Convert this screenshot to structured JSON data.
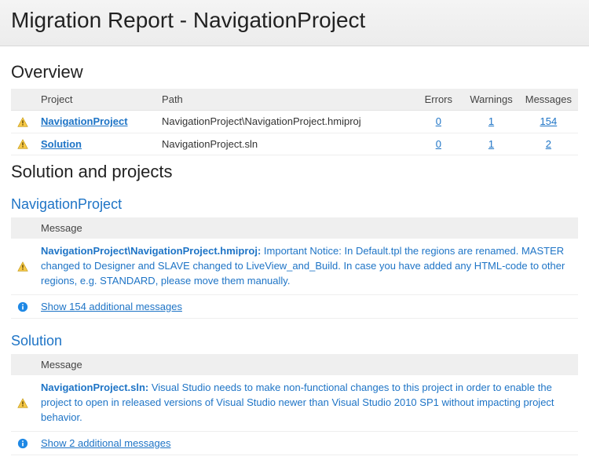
{
  "title": "Migration Report - NavigationProject",
  "overview": {
    "heading": "Overview",
    "columns": {
      "project": "Project",
      "path": "Path",
      "errors": "Errors",
      "warnings": "Warnings",
      "messages": "Messages"
    },
    "rows": [
      {
        "icon": "warning",
        "project": "NavigationProject",
        "path": "NavigationProject\\NavigationProject.hmiproj",
        "errors": "0",
        "warnings": "1",
        "messages": "154"
      },
      {
        "icon": "warning",
        "project": "Solution",
        "path": "NavigationProject.sln",
        "errors": "0",
        "warnings": "1",
        "messages": "2"
      }
    ]
  },
  "detail": {
    "heading": "Solution and projects",
    "message_col": "Message",
    "sections": [
      {
        "name": "NavigationProject",
        "msg_path": "NavigationProject\\NavigationProject.hmiproj:",
        "msg_text": " Important Notice: In Default.tpl the regions are renamed. MASTER changed to Designer and SLAVE changed to LiveView_and_Build. In case you have added any HTML-code to other regions, e.g. STANDARD, please move them manually.",
        "more_link": "Show 154 additional messages"
      },
      {
        "name": "Solution",
        "msg_path": "NavigationProject.sln:",
        "msg_text": " Visual Studio needs to make non-functional changes to this project in order to enable the project to open in released versions of Visual Studio newer than Visual Studio 2010 SP1 without impacting project behavior.",
        "more_link": "Show 2 additional messages"
      }
    ]
  }
}
